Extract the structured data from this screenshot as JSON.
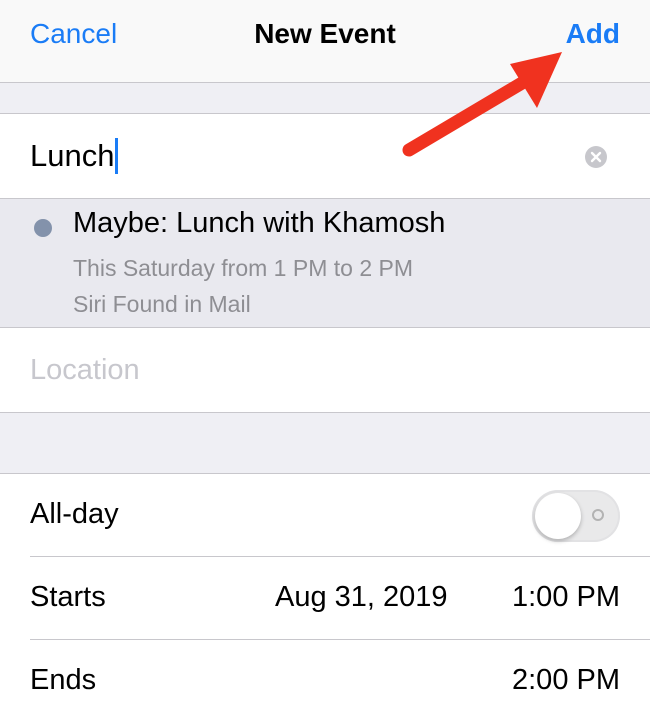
{
  "navbar": {
    "cancel_label": "Cancel",
    "title": "New Event",
    "add_label": "Add"
  },
  "title_field": {
    "value": "Lunch"
  },
  "suggestion": {
    "title": "Maybe: Lunch with Khamosh",
    "time": "This Saturday from 1 PM to 2 PM",
    "source": "Siri Found in Mail"
  },
  "location_field": {
    "placeholder": "Location"
  },
  "all_day": {
    "label": "All-day",
    "enabled": false
  },
  "starts": {
    "label": "Starts",
    "date": "Aug 31, 2019",
    "time": "1:00 PM"
  },
  "ends": {
    "label": "Ends",
    "time": "2:00 PM"
  },
  "colors": {
    "accent": "#1a7cf6",
    "annotation_arrow": "#f0321f"
  },
  "icons": {
    "clear": "clear-circle-icon",
    "annotation": "red-arrow-annotation"
  }
}
